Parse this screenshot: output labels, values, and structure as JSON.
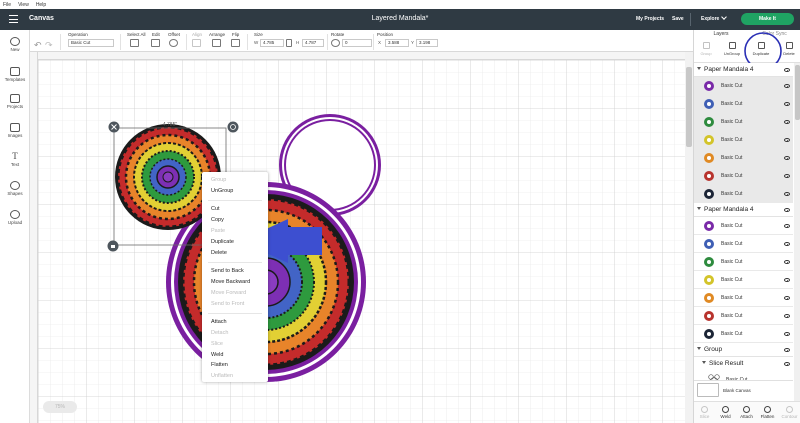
{
  "menubar": {
    "items": [
      "File",
      "View",
      "Help"
    ]
  },
  "header": {
    "section": "Canvas",
    "title": "Layered Mandala*",
    "my_projects": "My Projects",
    "save": "Save",
    "explore": "Explore",
    "make_it": "Make It"
  },
  "toolbar": {
    "undo_label": "",
    "operation_label": "Operation",
    "operation_value": "Basic Cut",
    "deselect_label": "Select All",
    "edit_label": "Edit",
    "offset_label": "Offset",
    "align_label": "Align",
    "arrange_label": "Arrange",
    "flip_label": "Flip",
    "size_label": "Size",
    "w_label": "W",
    "w_value": "4.785",
    "h_label": "H",
    "h_value": "4.787",
    "rotate_label": "Rotate",
    "rotate_value": "0",
    "position_label": "Position",
    "x_label": "X",
    "x_value": "3.588",
    "y_label": "Y",
    "y_value": "3.198"
  },
  "leftbar": {
    "items": [
      {
        "label": "New",
        "icon": "plus-icon"
      },
      {
        "label": "Templates",
        "icon": "shirt-icon"
      },
      {
        "label": "Projects",
        "icon": "projects-icon"
      },
      {
        "label": "Images",
        "icon": "image-icon"
      },
      {
        "label": "Text",
        "icon": "text-icon"
      },
      {
        "label": "Shapes",
        "icon": "shapes-icon"
      },
      {
        "label": "Upload",
        "icon": "upload-icon"
      }
    ]
  },
  "canvas": {
    "selection_width_label": "4.785\"",
    "zoom": "75%"
  },
  "context_menu": {
    "items": [
      {
        "label": "Group",
        "enabled": false
      },
      {
        "label": "UnGroup",
        "enabled": true
      },
      {
        "label": "Cut",
        "enabled": true
      },
      {
        "label": "Copy",
        "enabled": true
      },
      {
        "label": "Paste",
        "enabled": false
      },
      {
        "label": "Duplicate",
        "enabled": true
      },
      {
        "label": "Delete",
        "enabled": true
      },
      {
        "label": "Send to Back",
        "enabled": true
      },
      {
        "label": "Move Backward",
        "enabled": true
      },
      {
        "label": "Move Forward",
        "enabled": false
      },
      {
        "label": "Send to Front",
        "enabled": false
      },
      {
        "label": "Attach",
        "enabled": true
      },
      {
        "label": "Detach",
        "enabled": false
      },
      {
        "label": "Slice",
        "enabled": false
      },
      {
        "label": "Weld",
        "enabled": true
      },
      {
        "label": "Flatten",
        "enabled": true
      },
      {
        "label": "Unflatten",
        "enabled": false
      }
    ]
  },
  "right_panel": {
    "tabs": [
      "Layers",
      "Color Sync"
    ],
    "actions": [
      {
        "label": "Group",
        "enabled": false,
        "icon": "group-icon"
      },
      {
        "label": "UnGroup",
        "enabled": true,
        "icon": "ungroup-icon"
      },
      {
        "label": "Duplicate",
        "enabled": true,
        "icon": "duplicate-icon"
      },
      {
        "label": "Delete",
        "enabled": true,
        "icon": "trash-icon"
      }
    ],
    "groups": [
      {
        "name": "Paper Mandala 4",
        "selected": true,
        "layers": [
          {
            "label": "Basic Cut",
            "color": "#7a2aa8"
          },
          {
            "label": "Basic Cut",
            "color": "#3f5fb5"
          },
          {
            "label": "Basic Cut",
            "color": "#2e8b3e"
          },
          {
            "label": "Basic Cut",
            "color": "#d3c42a"
          },
          {
            "label": "Basic Cut",
            "color": "#e08a24"
          },
          {
            "label": "Basic Cut",
            "color": "#b8342e"
          },
          {
            "label": "Basic Cut",
            "color": "#1c2536"
          }
        ]
      },
      {
        "name": "Paper Mandala 4",
        "selected": false,
        "layers": [
          {
            "label": "Basic Cut",
            "color": "#7a2aa8"
          },
          {
            "label": "Basic Cut",
            "color": "#3f5fb5"
          },
          {
            "label": "Basic Cut",
            "color": "#2e8b3e"
          },
          {
            "label": "Basic Cut",
            "color": "#d3c42a"
          },
          {
            "label": "Basic Cut",
            "color": "#e08a24"
          },
          {
            "label": "Basic Cut",
            "color": "#b8342e"
          },
          {
            "label": "Basic Cut",
            "color": "#1c2536"
          }
        ]
      }
    ],
    "group3": {
      "name": "Group",
      "sub_name": "Slice Result",
      "sub_layer": "Basic Cut"
    },
    "blank_canvas": "Blank Canvas",
    "bottom_actions": [
      {
        "label": "Slice",
        "enabled": false
      },
      {
        "label": "Weld",
        "enabled": true
      },
      {
        "label": "Attach",
        "enabled": true
      },
      {
        "label": "Flatten",
        "enabled": true
      },
      {
        "label": "Contour",
        "enabled": false
      }
    ]
  },
  "colors": {
    "header_bg": "#2f3a43",
    "make_it": "#1fa363",
    "arrow": "#3d4fd0",
    "highlight_circle": "#2a2fb5",
    "ear_purple": "#7a1fa0"
  }
}
